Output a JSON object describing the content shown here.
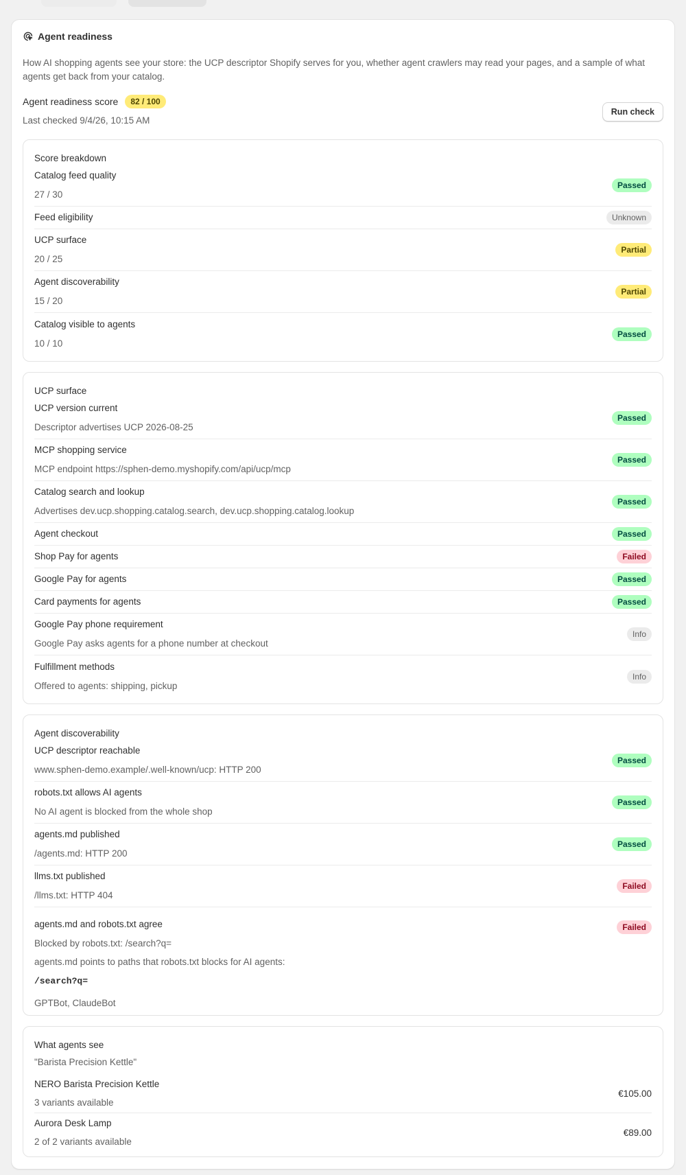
{
  "header": {
    "title": "Agent readiness",
    "description": "How AI shopping agents see your store: the UCP descriptor Shopify serves for you, whether agent crawlers may read your pages, and a sample of what agents get back from your catalog.",
    "score_label": "Agent readiness score",
    "score_value": "82 / 100",
    "last_checked": "Last checked 9/4/26, 10:15 AM",
    "run_check_label": "Run check"
  },
  "colors": {
    "passed_bg": "#affebf",
    "partial_bg": "#ffeb78",
    "failed_bg": "#fed1d7",
    "neutral_bg": "#ebebeb"
  },
  "score_breakdown": {
    "title": "Score breakdown",
    "rows": [
      {
        "name": "Catalog feed quality",
        "detail": "27 / 30",
        "status": "Passed"
      },
      {
        "name": "Feed eligibility",
        "status": "Unknown"
      },
      {
        "name": "UCP surface",
        "detail": "20 / 25",
        "status": "Partial"
      },
      {
        "name": "Agent discoverability",
        "detail": "15 / 20",
        "status": "Partial"
      },
      {
        "name": "Catalog visible to agents",
        "detail": "10 / 10",
        "status": "Passed"
      }
    ]
  },
  "ucp_surface": {
    "title": "UCP surface",
    "rows": [
      {
        "name": "UCP version current",
        "detail": "Descriptor advertises UCP 2026-08-25",
        "status": "Passed"
      },
      {
        "name": "MCP shopping service",
        "detail": "MCP endpoint https://sphen-demo.myshopify.com/api/ucp/mcp",
        "status": "Passed"
      },
      {
        "name": "Catalog search and lookup",
        "detail": "Advertises dev.ucp.shopping.catalog.search, dev.ucp.shopping.catalog.lookup",
        "status": "Passed"
      },
      {
        "name": "Agent checkout",
        "status": "Passed"
      },
      {
        "name": "Shop Pay for agents",
        "status": "Failed"
      },
      {
        "name": "Google Pay for agents",
        "status": "Passed"
      },
      {
        "name": "Card payments for agents",
        "status": "Passed"
      },
      {
        "name": "Google Pay phone requirement",
        "detail": "Google Pay asks agents for a phone number at checkout",
        "status": "Info"
      },
      {
        "name": "Fulfillment methods",
        "detail": "Offered to agents: shipping, pickup",
        "status": "Info"
      }
    ]
  },
  "agent_discoverability": {
    "title": "Agent discoverability",
    "rows": [
      {
        "name": "UCP descriptor reachable",
        "detail": "www.sphen-demo.example/.well-known/ucp: HTTP 200",
        "status": "Passed"
      },
      {
        "name": "robots.txt allows AI agents",
        "detail": "No AI agent is blocked from the whole shop",
        "status": "Passed"
      },
      {
        "name": "agents.md published",
        "detail": "/agents.md: HTTP 200",
        "status": "Passed"
      },
      {
        "name": "llms.txt published",
        "detail": "/llms.txt: HTTP 404",
        "status": "Failed"
      }
    ],
    "conflict": {
      "name": "agents.md and robots.txt agree",
      "status": "Failed",
      "blocked": "Blocked by robots.txt: /search?q=",
      "explanation": "agents.md points to paths that robots.txt blocks for AI agents:",
      "path": "/search?q=",
      "agents": "GPTBot, ClaudeBot"
    }
  },
  "what_agents_see": {
    "title": "What agents see",
    "query": "\"Barista Precision Kettle\"",
    "products": [
      {
        "name": "NERO Barista Precision Kettle",
        "variants": "3 variants available",
        "price": "€105.00"
      },
      {
        "name": "Aurora Desk Lamp",
        "variants": "2 of 2 variants available",
        "price": "€89.00"
      }
    ]
  }
}
